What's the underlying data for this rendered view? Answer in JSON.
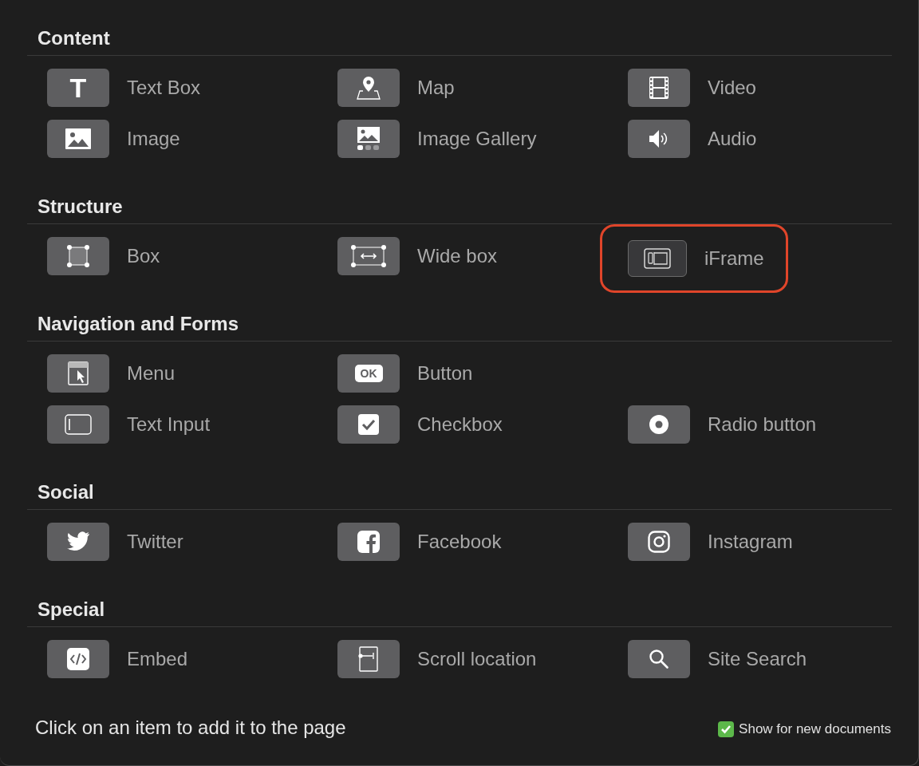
{
  "sections": [
    {
      "title": "Content",
      "rows": [
        [
          {
            "label": "Text Box",
            "icon_text": "T",
            "selected": false
          },
          {
            "label": "Map",
            "selected": false
          },
          {
            "label": "Video",
            "selected": false
          }
        ],
        [
          {
            "label": "Image",
            "selected": false
          },
          {
            "label": "Image Gallery",
            "selected": false
          },
          {
            "label": "Audio",
            "selected": false
          }
        ]
      ]
    },
    {
      "title": "Structure",
      "rows": [
        [
          {
            "label": "Box",
            "selected": false
          },
          {
            "label": "Wide box",
            "selected": false
          },
          {
            "label": "iFrame",
            "selected": true
          }
        ]
      ]
    },
    {
      "title": "Navigation and Forms",
      "rows": [
        [
          {
            "label": "Menu",
            "selected": false
          },
          {
            "label": "Button",
            "icon_text": "OK",
            "selected": false
          }
        ],
        [
          {
            "label": "Text Input",
            "selected": false
          },
          {
            "label": "Checkbox",
            "selected": false
          },
          {
            "label": "Radio button",
            "selected": false
          }
        ]
      ]
    },
    {
      "title": "Social",
      "rows": [
        [
          {
            "label": "Twitter",
            "selected": false
          },
          {
            "label": "Facebook",
            "selected": false
          },
          {
            "label": "Instagram",
            "selected": false
          }
        ]
      ]
    },
    {
      "title": "Special",
      "rows": [
        [
          {
            "label": "Embed",
            "selected": false
          },
          {
            "label": "Scroll location",
            "selected": false
          },
          {
            "label": "Site Search",
            "selected": false
          }
        ]
      ]
    }
  ],
  "hint": "Click on an item to add it to the page",
  "show_for_new_documents": {
    "label": "Show for new documents",
    "checked": true
  }
}
